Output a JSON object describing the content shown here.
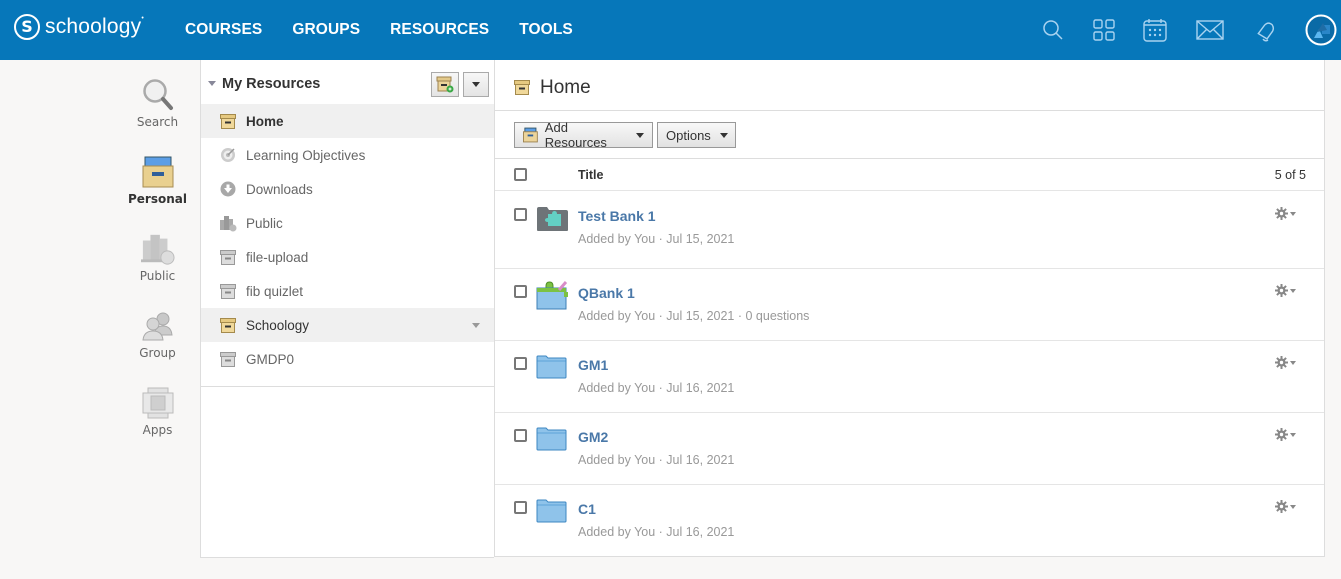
{
  "header": {
    "logo_text": "schoology",
    "logo_mark": "S",
    "nav": [
      "COURSES",
      "GROUPS",
      "RESOURCES",
      "TOOLS"
    ],
    "icons": [
      "search-icon",
      "apps-grid-icon",
      "calendar-icon",
      "mail-icon",
      "bell-icon",
      "avatar"
    ],
    "colors": {
      "bar": "#0677ba"
    }
  },
  "rail": {
    "items": [
      {
        "label": "Search",
        "icon": "search-icon",
        "active": false
      },
      {
        "label": "Personal",
        "icon": "personal-box-icon",
        "active": true
      },
      {
        "label": "Public",
        "icon": "library-icon",
        "active": false
      },
      {
        "label": "Group",
        "icon": "group-icon",
        "active": false
      },
      {
        "label": "Apps",
        "icon": "apps-icon",
        "active": false
      }
    ]
  },
  "tree": {
    "title": "My Resources",
    "items": [
      {
        "label": "Home",
        "icon": "box-icon-gold",
        "selected": true
      },
      {
        "label": "Learning Objectives",
        "icon": "target-icon"
      },
      {
        "label": "Downloads",
        "icon": "download-icon"
      },
      {
        "label": "Public",
        "icon": "library-icon"
      },
      {
        "label": "file-upload",
        "icon": "box-icon-gray"
      },
      {
        "label": "fib quizlet",
        "icon": "box-icon-gray"
      },
      {
        "label": "Schoology",
        "icon": "box-icon-gold",
        "hover": true
      },
      {
        "label": "GMDP0",
        "icon": "box-icon-gray"
      }
    ]
  },
  "main": {
    "title": "Home",
    "toolbar": {
      "add_resources": "Add Resources",
      "options": "Options"
    },
    "list": {
      "column_title": "Title",
      "count": "5 of 5",
      "rows": [
        {
          "title": "Test Bank 1",
          "meta": "Added by You · Jul 15, 2021",
          "icon": "test-bank-icon"
        },
        {
          "title": "QBank 1",
          "meta": "Added by You · Jul 15, 2021 · 0 questions",
          "icon": "question-bank-icon"
        },
        {
          "title": "GM1",
          "meta": "Added by You · Jul 16, 2021",
          "icon": "folder-icon"
        },
        {
          "title": "GM2",
          "meta": "Added by You · Jul 16, 2021",
          "icon": "folder-icon"
        },
        {
          "title": "C1",
          "meta": "Added by You · Jul 16, 2021",
          "icon": "folder-icon"
        }
      ]
    }
  }
}
